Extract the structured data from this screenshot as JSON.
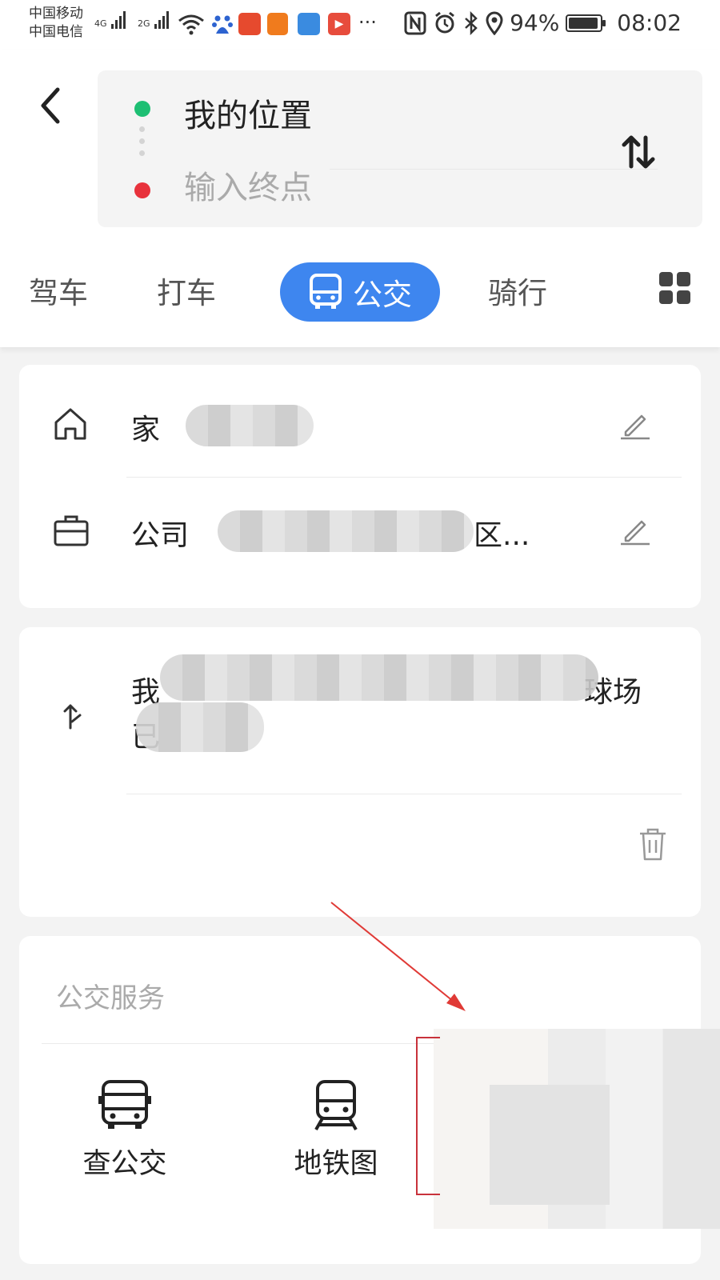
{
  "status_bar": {
    "carrier_1": "中国移动",
    "carrier_2": "中国电信",
    "net_1": "4G",
    "net_2": "2G",
    "battery_pct": "94%",
    "time": "08:02",
    "app_icon_colors": [
      "#e64a2e",
      "#f07b1d",
      "#3a8be0",
      "#e74c3c"
    ]
  },
  "route": {
    "from": "我的位置",
    "to_placeholder": "输入终点"
  },
  "tabs": {
    "drive": "驾车",
    "taxi": "打车",
    "bus": "公交",
    "bike": "骑行",
    "active_color": "#3e86ef"
  },
  "favorites": {
    "home_label": "家",
    "company_label": "公司",
    "company_suffix": "区..."
  },
  "history": {
    "line_1_start": "我",
    "line_1_end": "球场",
    "line_2_start": "已"
  },
  "bus_services": {
    "title": "公交服务",
    "items": [
      "查公交",
      "地铁图"
    ]
  },
  "annotation_color": "#e03a36"
}
